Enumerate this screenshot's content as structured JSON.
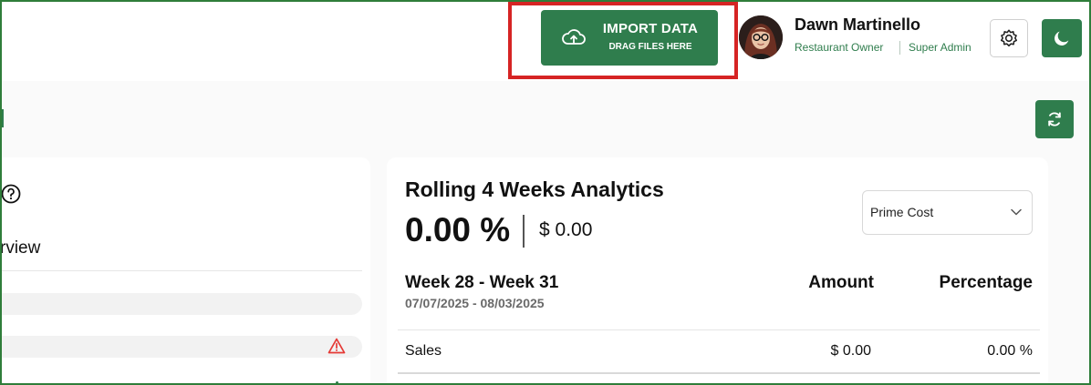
{
  "header": {
    "import_button": {
      "title": "IMPORT DATA",
      "subtitle": "DRAG FILES HERE",
      "icon": "cloud-upload-icon"
    },
    "user": {
      "name": "Dawn Martinello",
      "role": "Restaurant Owner",
      "admin_level": "Super Admin",
      "avatar_icon": "user-avatar"
    },
    "settings_icon": "gear-icon",
    "theme_icon": "moon-icon"
  },
  "toolbar": {
    "refresh_icon": "refresh-icon"
  },
  "left_panel": {
    "help_icon": "question-circle-icon",
    "section_title": "rview",
    "warning_icon": "warning-triangle-icon"
  },
  "analytics": {
    "title": "Rolling 4 Weeks Analytics",
    "percentage": "0.00 %",
    "amount": "$ 0.00",
    "metric_select": {
      "selected": "Prime Cost",
      "icon": "chevron-down-icon"
    },
    "table": {
      "period_label": "Week 28 - Week 31",
      "period_dates": "07/07/2025 - 08/03/2025",
      "columns": [
        "Amount",
        "Percentage"
      ],
      "rows": [
        {
          "label": "Sales",
          "amount": "$ 0.00",
          "percentage": "0.00 %"
        }
      ]
    }
  },
  "colors": {
    "brand_green": "#2f7d4d",
    "highlight_red": "#d62424",
    "warning_red": "#e53935"
  }
}
